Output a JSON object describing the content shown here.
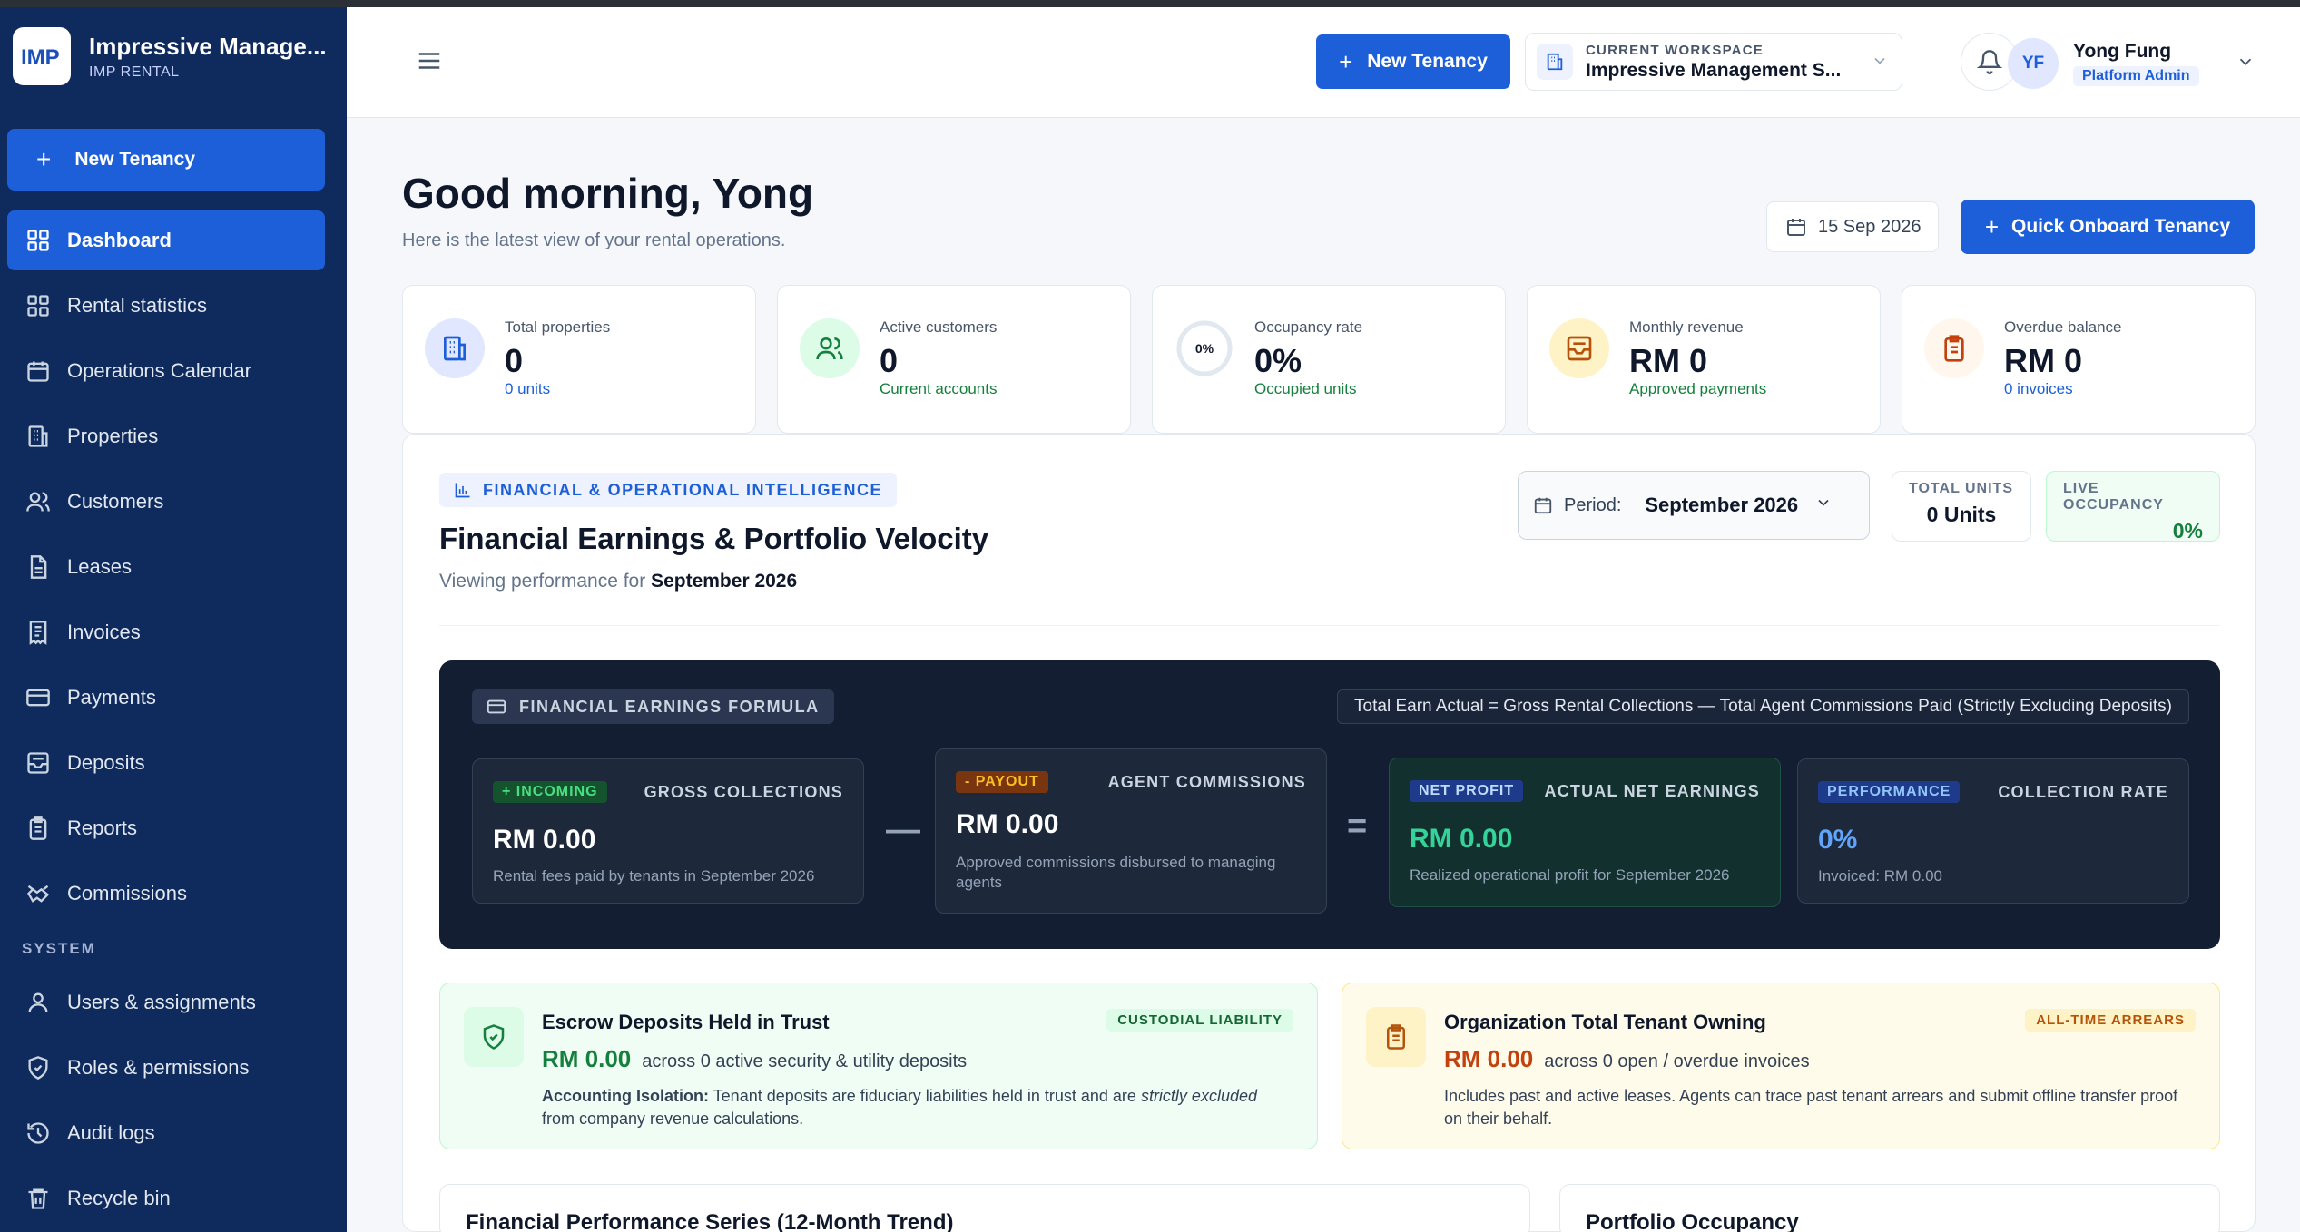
{
  "brand": {
    "logo_text": "IMP",
    "title": "Impressive Manage...",
    "subtitle": "IMP RENTAL"
  },
  "sidebar": {
    "new_label": "New Tenancy",
    "items": [
      {
        "label": "Dashboard",
        "icon": "grid-icon",
        "active": true
      },
      {
        "label": "Rental statistics",
        "icon": "grid-icon"
      },
      {
        "label": "Operations Calendar",
        "icon": "calendar-icon"
      },
      {
        "label": "Properties",
        "icon": "building-icon"
      },
      {
        "label": "Customers",
        "icon": "users-icon"
      },
      {
        "label": "Leases",
        "icon": "document-icon"
      },
      {
        "label": "Invoices",
        "icon": "receipt-icon"
      },
      {
        "label": "Payments",
        "icon": "card-icon"
      },
      {
        "label": "Deposits",
        "icon": "inbox-icon"
      },
      {
        "label": "Reports",
        "icon": "clipboard-icon"
      },
      {
        "label": "Commissions",
        "icon": "handshake-icon"
      }
    ],
    "system_heading": "SYSTEM",
    "system_items": [
      {
        "label": "Users & assignments",
        "icon": "user-icon"
      },
      {
        "label": "Roles & permissions",
        "icon": "shield-icon"
      },
      {
        "label": "Audit logs",
        "icon": "history-icon"
      },
      {
        "label": "Recycle bin",
        "icon": "trash-icon"
      }
    ]
  },
  "topbar": {
    "new_label": "New Tenancy",
    "workspace_label": "CURRENT WORKSPACE",
    "workspace_value": "Impressive Management S...",
    "user_initials": "YF",
    "user_name": "Yong Fung",
    "user_role": "Platform Admin"
  },
  "header": {
    "greeting": "Good morning, Yong",
    "subtitle": "Here is the latest view of your rental operations.",
    "date": "15 Sep 2026",
    "quick_label": "Quick Onboard Tenancy"
  },
  "stats": [
    {
      "label": "Total properties",
      "value": "0",
      "sub": "0 units",
      "sub_color": "#1d5fd8",
      "icon": "building-icon"
    },
    {
      "label": "Active customers",
      "value": "0",
      "sub": "Current accounts",
      "sub_color": "#15803d",
      "icon": "users-icon"
    },
    {
      "label": "Occupancy rate",
      "value": "0%",
      "sub": "Occupied units",
      "sub_color": "#15803d",
      "icon": "ring-chart-icon",
      "ring_text": "0%"
    },
    {
      "label": "Monthly revenue",
      "value": "RM 0",
      "sub": "Approved payments",
      "sub_color": "#15803d",
      "icon": "inbox-icon"
    },
    {
      "label": "Overdue balance",
      "value": "RM 0",
      "sub": "0 invoices",
      "sub_color": "#1d5fd8",
      "icon": "clipboard-icon"
    }
  ],
  "panel": {
    "badge": "FINANCIAL & OPERATIONAL INTELLIGENCE",
    "title": "Financial Earnings & Portfolio Velocity",
    "sub_prefix": "Viewing performance for",
    "sub_period": "September 2026",
    "period_label": "Period:",
    "period_value": "September 2026",
    "total_units_label": "TOTAL UNITS",
    "total_units_value": "0 Units",
    "live_occ_label": "LIVE OCCUPANCY",
    "live_occ_value": "0%"
  },
  "formula": {
    "badge": "FINANCIAL EARNINGS FORMULA",
    "equation": "Total Earn Actual = Gross Rental Collections — Total Agent Commissions Paid (Strictly Excluding Deposits)",
    "minus": "—",
    "equals": "=",
    "cards": [
      {
        "tag": "+ INCOMING",
        "name": "GROSS COLLECTIONS",
        "value": "RM 0.00",
        "desc": "Rental fees paid by tenants in September 2026"
      },
      {
        "tag": "- PAYOUT",
        "name": "AGENT COMMISSIONS",
        "value": "RM 0.00",
        "desc": "Approved commissions disbursed to managing agents"
      },
      {
        "tag": "NET PROFIT",
        "name": "ACTUAL NET EARNINGS",
        "value": "RM 0.00",
        "desc": "Realized operational profit for September 2026"
      },
      {
        "tag": "PERFORMANCE",
        "name": "COLLECTION RATE",
        "value": "0%",
        "desc": "Invoiced: RM 0.00"
      }
    ]
  },
  "escrow": {
    "title": "Escrow Deposits Held in Trust",
    "tag": "CUSTODIAL LIABILITY",
    "amount": "RM 0.00",
    "amount_note": "across 0 active security & utility deposits",
    "desc_bold": "Accounting Isolation:",
    "desc_a": " Tenant deposits are fiduciary liabilities held in trust and are ",
    "desc_em": "strictly excluded",
    "desc_b": " from company revenue calculations."
  },
  "owning": {
    "title": "Organization Total Tenant Owning",
    "tag": "ALL-TIME ARREARS",
    "amount": "RM 0.00",
    "amount_note": "across 0 open / overdue invoices",
    "desc": "Includes past and active leases. Agents can trace past tenant arrears and submit offline transfer proof on their behalf."
  },
  "bottom": {
    "left_title": "Financial Performance Series (12-Month Trend)",
    "right_title": "Portfolio Occupancy"
  }
}
